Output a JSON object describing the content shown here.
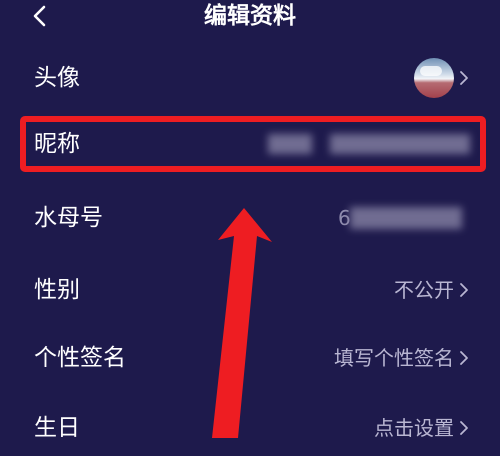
{
  "header": {
    "back_icon": "chevron-left-icon",
    "title": "编辑资料"
  },
  "rows": [
    {
      "id": "avatar",
      "label": "头像",
      "value_type": "avatar-image"
    },
    {
      "id": "nickname",
      "label": "昵称",
      "value_type": "redacted"
    },
    {
      "id": "id",
      "label": "水母号",
      "value_partial": "6",
      "value_type": "redacted"
    },
    {
      "id": "gender",
      "label": "性别",
      "value": "不公开"
    },
    {
      "id": "signature",
      "label": "个性签名",
      "value": "填写个性签名"
    },
    {
      "id": "birthday",
      "label": "生日",
      "value": "点击设置"
    }
  ],
  "annotation": {
    "highlight_color": "#ee1d22",
    "highlighted_row": "nickname"
  },
  "colors": {
    "background": "#1e1a4c",
    "text": "#ffffff",
    "value_text": "#b9b6d2"
  }
}
